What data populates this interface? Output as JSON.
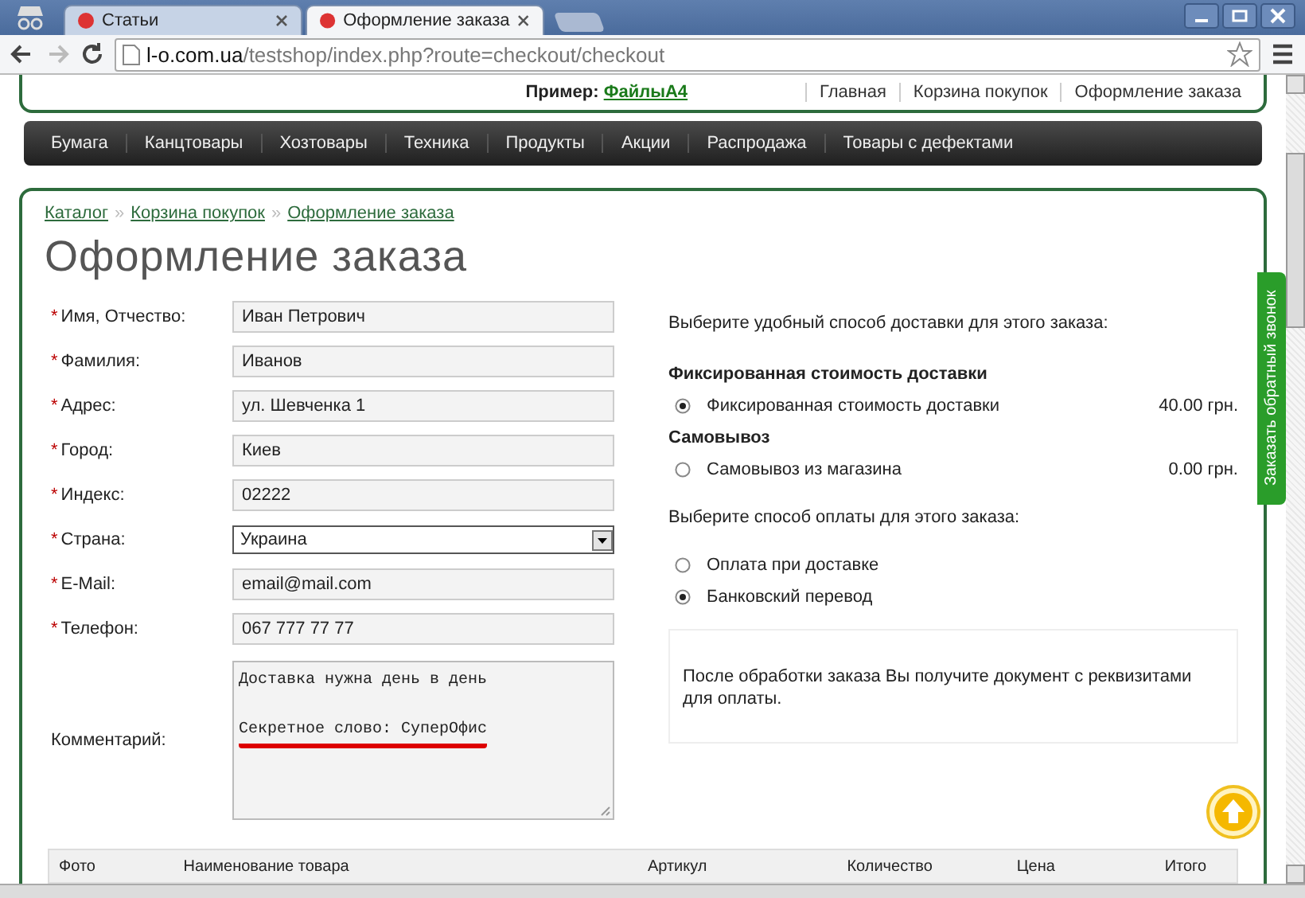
{
  "browser": {
    "tabs": [
      {
        "title": "Статьи",
        "selected": false
      },
      {
        "title": "Оформление заказа",
        "selected": true
      }
    ],
    "url_host": "l-o.com.ua",
    "url_path": "/testshop/index.php?route=checkout/checkout"
  },
  "header": {
    "example_label": "Пример:",
    "example_link": "ФайлыА4",
    "links": [
      "Главная",
      "Корзина покупок",
      "Оформление заказа"
    ]
  },
  "menu": [
    "Бумага",
    "Канцтовары",
    "Хозтовары",
    "Техника",
    "Продукты",
    "Акции",
    "Распродажа",
    "Товары с дефектами"
  ],
  "breadcrumbs": [
    "Каталог",
    "Корзина покупок",
    "Оформление заказа"
  ],
  "breadcrumb_separator": "»",
  "required_mark": "*",
  "title": "Оформление заказа",
  "form": [
    {
      "label": "Имя, Отчество:",
      "required": true,
      "kind": "text",
      "value": "Иван Петрович"
    },
    {
      "label": "Фамилия:",
      "required": true,
      "kind": "text",
      "value": "Иванов"
    },
    {
      "label": "Адрес:",
      "required": true,
      "kind": "text",
      "value": "ул. Шевченка 1"
    },
    {
      "label": "Город:",
      "required": true,
      "kind": "text",
      "value": "Киев"
    },
    {
      "label": "Индекс:",
      "required": true,
      "kind": "text",
      "value": "02222"
    },
    {
      "label": "Страна:",
      "required": true,
      "kind": "select",
      "value": "Украина"
    },
    {
      "label": "E-Mail:",
      "required": true,
      "kind": "text",
      "value": "email@mail.com"
    },
    {
      "label": "Телефон:",
      "required": true,
      "kind": "text",
      "value": "067 777 77 77"
    }
  ],
  "comment": {
    "label": "Комментарий:",
    "lines": [
      {
        "text": "Доставка нужна день в день",
        "underlined": false
      },
      {
        "text": "Секретное слово: СуперОфис",
        "underlined": true
      }
    ]
  },
  "shipping": {
    "prompt": "Выберите удобный способ доставки для этого заказа:",
    "groups": [
      {
        "title": "Фиксированная стоимость доставки",
        "options": [
          {
            "label": "Фиксированная стоимость доставки",
            "price": "40.00 грн.",
            "selected": true
          }
        ]
      },
      {
        "title": "Самовывоз",
        "options": [
          {
            "label": "Самовывоз из магазина",
            "price": "0.00 грн.",
            "selected": false
          }
        ]
      }
    ]
  },
  "payment": {
    "prompt": "Выберите способ оплаты для этого заказа:",
    "options": [
      {
        "label": "Оплата при доставке",
        "selected": false
      },
      {
        "label": "Банковский перевод",
        "selected": true
      }
    ]
  },
  "payment_note": "После обработки заказа Вы получите документ с реквизитами для оплаты.",
  "table": {
    "columns": [
      "Фото",
      "Наименование товара",
      "Артикул",
      "Количество",
      "Цена",
      "Итого"
    ]
  },
  "callback_tab": "Заказать обратный звонок"
}
